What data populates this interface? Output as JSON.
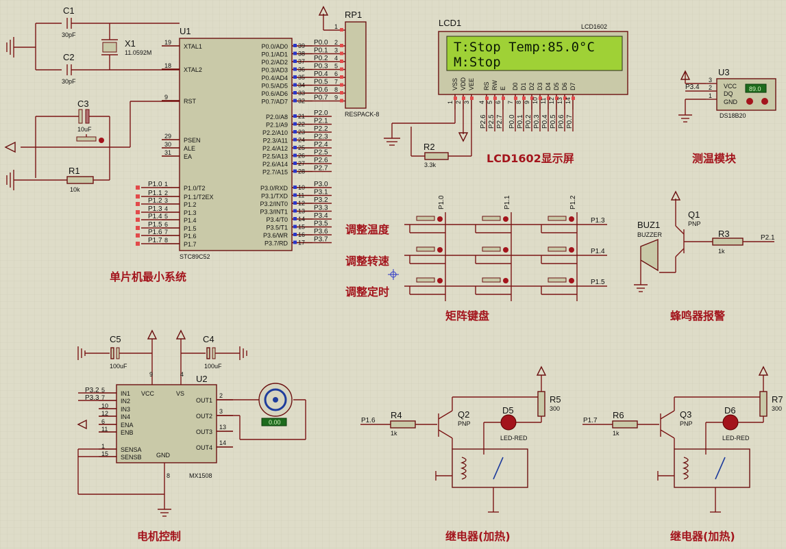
{
  "sections": {
    "mcu": "单片机最小系统",
    "lcd": "LCD1602显示屏",
    "temp": "测温模块",
    "keypad": "矩阵键盘",
    "buzzer": "蜂鸣器报警",
    "motor": "电机控制",
    "relay1": "继电器(加热)",
    "relay2": "继电器(加热)"
  },
  "keypad_rows": [
    "调整温度",
    "调整转速",
    "调整定时"
  ],
  "lcd": {
    "ref": "LCD1",
    "model": "LCD1602",
    "line1": "T:Stop Temp:85.0°C",
    "line2": "M:Stop",
    "pins": [
      "VSS",
      "VDD",
      "VEE",
      "RS",
      "RW",
      "E",
      "D0",
      "D1",
      "D2",
      "D3",
      "D4",
      "D5",
      "D6",
      "D7"
    ],
    "pin_nums": [
      "1",
      "2",
      "3",
      "4",
      "5",
      "6",
      "7",
      "8",
      "9",
      "10",
      "11",
      "12",
      "13",
      "14"
    ],
    "nets": [
      "P2.6",
      "P2.5",
      "P2.7",
      "P0.0",
      "P0.1",
      "P0.2",
      "P0.3",
      "P0.4",
      "P0.5",
      "P0.6",
      "P0.7"
    ]
  },
  "mcu": {
    "ref": "U1",
    "model": "STC89C52",
    "left_pins": [
      {
        "num": "19",
        "name": "XTAL1"
      },
      {
        "num": "18",
        "name": "XTAL2"
      },
      {
        "num": "9",
        "name": "RST"
      },
      {
        "num": "29",
        "name": "PSEN"
      },
      {
        "num": "30",
        "name": "ALE"
      },
      {
        "num": "31",
        "name": "EA"
      },
      {
        "num": "1",
        "name": "P1.0/T2"
      },
      {
        "num": "2",
        "name": "P1.1/T2EX"
      },
      {
        "num": "3",
        "name": "P1.2"
      },
      {
        "num": "4",
        "name": "P1.3"
      },
      {
        "num": "5",
        "name": "P1.4"
      },
      {
        "num": "6",
        "name": "P1.5"
      },
      {
        "num": "7",
        "name": "P1.6"
      },
      {
        "num": "8",
        "name": "P1.7"
      }
    ],
    "left_nets": [
      "P1.0",
      "P1.1",
      "P1.2",
      "P1.3",
      "P1.4",
      "P1.5",
      "P1.6",
      "P1.7"
    ],
    "right_pins": [
      {
        "num": "39",
        "name": "P0.0/AD0",
        "net": "P0.0"
      },
      {
        "num": "38",
        "name": "P0.1/AD1",
        "net": "P0.1"
      },
      {
        "num": "37",
        "name": "P0.2/AD2",
        "net": "P0.2"
      },
      {
        "num": "36",
        "name": "P0.3/AD3",
        "net": "P0.3"
      },
      {
        "num": "35",
        "name": "P0.4/AD4",
        "net": "P0.4"
      },
      {
        "num": "34",
        "name": "P0.5/AD5",
        "net": "P0.5"
      },
      {
        "num": "33",
        "name": "P0.6/AD6",
        "net": "P0.6"
      },
      {
        "num": "32",
        "name": "P0.7/AD7",
        "net": "P0.7"
      },
      {
        "num": "21",
        "name": "P2.0/A8",
        "net": "P2.0"
      },
      {
        "num": "22",
        "name": "P2.1/A9",
        "net": "P2.1"
      },
      {
        "num": "23",
        "name": "P2.2/A10",
        "net": "P2.2"
      },
      {
        "num": "24",
        "name": "P2.3/A11",
        "net": "P2.3"
      },
      {
        "num": "25",
        "name": "P2.4/A12",
        "net": "P2.4"
      },
      {
        "num": "26",
        "name": "P2.5/A13",
        "net": "P2.5"
      },
      {
        "num": "27",
        "name": "P2.6/A14",
        "net": "P2.6"
      },
      {
        "num": "28",
        "name": "P2.7/A15",
        "net": "P2.7"
      },
      {
        "num": "10",
        "name": "P3.0/RXD",
        "net": "P3.0"
      },
      {
        "num": "11",
        "name": "P3.1/TXD",
        "net": "P3.1"
      },
      {
        "num": "12",
        "name": "P3.2/INT0",
        "net": "P3.2"
      },
      {
        "num": "13",
        "name": "P3.3/INT1",
        "net": "P3.3"
      },
      {
        "num": "14",
        "name": "P3.4/T0",
        "net": "P3.4"
      },
      {
        "num": "15",
        "name": "P3.5/T1",
        "net": "P3.5"
      },
      {
        "num": "16",
        "name": "P3.6/WR",
        "net": "P3.6"
      },
      {
        "num": "17",
        "name": "P3.7/RD",
        "net": "P3.7"
      }
    ]
  },
  "crystal": {
    "c1": "C1",
    "c1v": "30pF",
    "c2": "C2",
    "c2v": "30pF",
    "x1": "X1",
    "x1v": "11.0592M",
    "c3": "C3",
    "c3v": "10uF",
    "r1": "R1",
    "r1v": "10k"
  },
  "respack": {
    "ref": "RP1",
    "model": "RESPACK-8",
    "pin_nums": [
      "1",
      "2",
      "3",
      "4",
      "5",
      "6",
      "7",
      "8",
      "9"
    ]
  },
  "r2": {
    "ref": "R2",
    "value": "3.3k"
  },
  "ds18b20": {
    "ref": "U3",
    "model": "DS18B20",
    "net": "P3.4",
    "reading": "89.0",
    "pins": [
      "VCC",
      "DQ",
      "GND"
    ],
    "pin_nums": [
      "3",
      "2",
      "1"
    ]
  },
  "keypad": {
    "col_nets": [
      "P1.0",
      "P1.1",
      "P1.2"
    ],
    "row_nets": [
      "P1.3",
      "P1.4",
      "P1.5"
    ]
  },
  "buzzer": {
    "buz": "BUZ1",
    "buz_model": "BUZZER",
    "q": "Q1",
    "q_type": "PNP",
    "r": "R3",
    "r_val": "1k",
    "net": "P2.1"
  },
  "motor": {
    "c5": "C5",
    "c5v": "100uF",
    "c4": "C4",
    "c4v": "100uF",
    "ref": "U2",
    "model": "MX1508",
    "speed": "0.00",
    "left_pins": [
      {
        "num": "5",
        "name": "IN1"
      },
      {
        "num": "7",
        "name": "IN2"
      },
      {
        "num": "10",
        "name": "IN3"
      },
      {
        "num": "12",
        "name": "IN4"
      },
      {
        "num": "6",
        "name": "ENA"
      },
      {
        "num": "11",
        "name": "ENB"
      },
      {
        "num": "1",
        "name": "SENSA"
      },
      {
        "num": "15",
        "name": "SENSB"
      }
    ],
    "left_nets": [
      "P3.2",
      "P3.3"
    ],
    "right_pins": [
      {
        "num": "2",
        "name": "OUT1"
      },
      {
        "num": "3",
        "name": "OUT2"
      },
      {
        "num": "13",
        "name": "OUT3"
      },
      {
        "num": "14",
        "name": "OUT4"
      }
    ],
    "top_pins": [
      {
        "num": "9",
        "name": "VCC"
      },
      {
        "num": "4",
        "name": "VS"
      }
    ],
    "gnd": {
      "num": "8",
      "name": "GND"
    }
  },
  "relay1": {
    "net": "P1.6",
    "r": "R4",
    "r_val": "1k",
    "q": "Q2",
    "q_type": "PNP",
    "d": "D5",
    "d_model": "LED-RED",
    "r2": "R5",
    "r2_val": "300"
  },
  "relay2": {
    "net": "P1.7",
    "r": "R6",
    "r_val": "1k",
    "q": "Q3",
    "q_type": "PNP",
    "d": "D6",
    "d_model": "LED-RED",
    "r2": "R7",
    "r2_val": "300"
  },
  "colors": {
    "background": "#dedcc8",
    "wire": "#7a1414",
    "component": "#c9c9a8",
    "section_label": "#a3141c",
    "lcd_screen": "#9fd136"
  }
}
